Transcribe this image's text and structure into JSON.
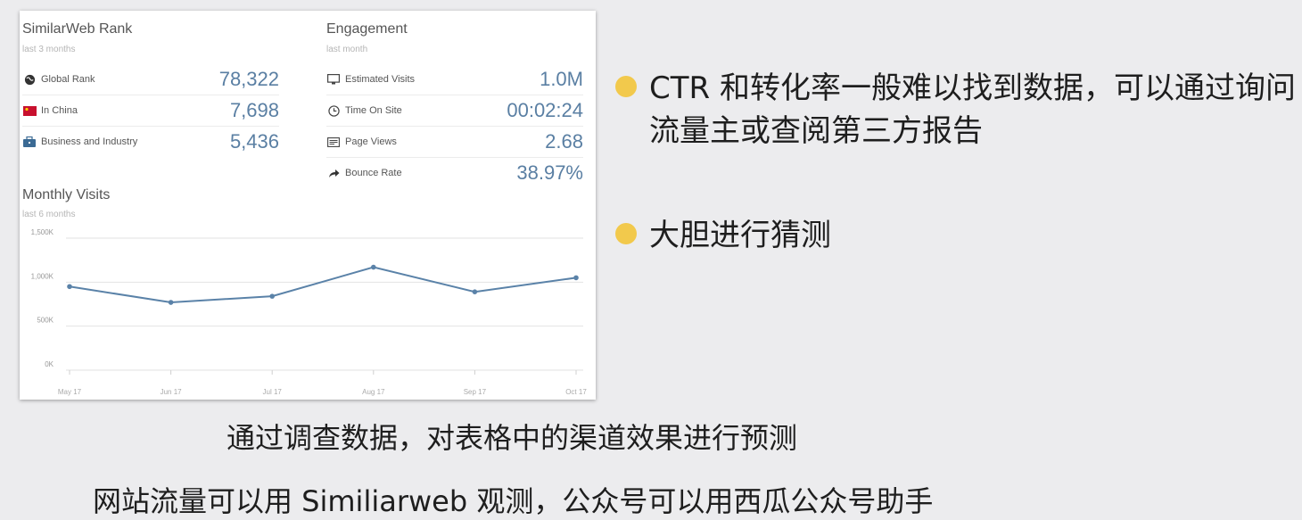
{
  "rank": {
    "title": "SimilarWeb Rank",
    "subtitle": "last 3 months",
    "rows": [
      {
        "label": "Global Rank",
        "value": "78,322",
        "icon": "globe-icon"
      },
      {
        "label": "In China",
        "value": "7,698",
        "icon": "china-flag-icon"
      },
      {
        "label": "Business and Industry",
        "value": "5,436",
        "icon": "briefcase-icon"
      }
    ]
  },
  "engagement": {
    "title": "Engagement",
    "subtitle": "last month",
    "rows": [
      {
        "label": "Estimated Visits",
        "value": "1.0M",
        "icon": "monitor-icon"
      },
      {
        "label": "Time On Site",
        "value": "00:02:24",
        "icon": "clock-icon"
      },
      {
        "label": "Page Views",
        "value": "2.68",
        "icon": "pages-icon"
      },
      {
        "label": "Bounce Rate",
        "value": "38.97%",
        "icon": "arrow-icon"
      }
    ]
  },
  "monthly": {
    "title": "Monthly Visits",
    "subtitle": "last 6 months"
  },
  "chart_data": {
    "type": "line",
    "title": "Monthly Visits",
    "subtitle": "last 6 months",
    "categories": [
      "May 17",
      "Jun 17",
      "Jul 17",
      "Aug 17",
      "Sep 17",
      "Oct 17"
    ],
    "values": [
      950000,
      770000,
      840000,
      1170000,
      890000,
      1050000
    ],
    "y_ticks": [
      "0K",
      "500K",
      "1,000K",
      "1,500K"
    ],
    "ylim": [
      0,
      1500000
    ],
    "grid": true,
    "legend": "none",
    "line_color": "#5a82a8"
  },
  "bullets": [
    {
      "text": "CTR 和转化率一般难以找到数据，可以通过询问流量主或查阅第三方报告"
    },
    {
      "text": "大胆进行猜测"
    }
  ],
  "captions": {
    "line1": "通过调查数据，对表格中的渠道效果进行预测",
    "line2": "网站流量可以用 Similiarweb 观测，公众号可以用西瓜公众号助手"
  },
  "colors": {
    "bullet": "#f2c94c",
    "value": "#5a7fa3",
    "background": "#ececee"
  }
}
